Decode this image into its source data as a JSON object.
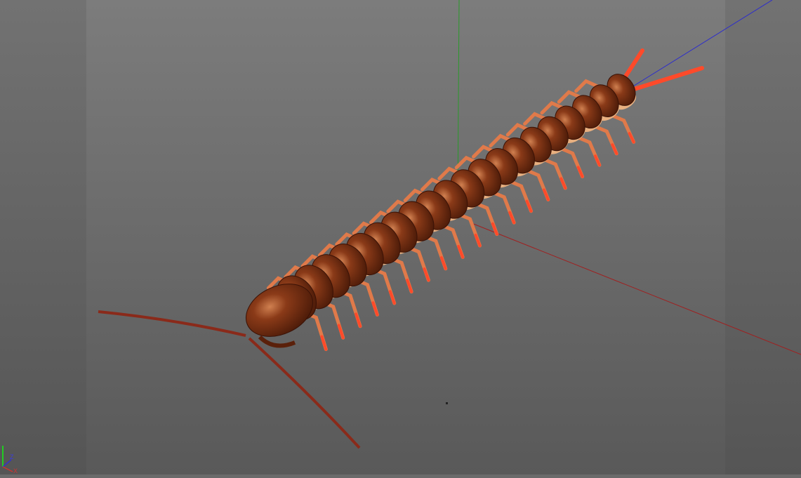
{
  "viewport": {
    "background_top": "#7c7c7c",
    "background_bottom": "#595959",
    "side_panel_color": "#6b6b6b",
    "axis_colors": {
      "x": "#b02020",
      "y": "#2a9a2a",
      "z": "#2a2ad0"
    }
  },
  "gizmo": {
    "z_label": "Z",
    "x_label": "X"
  },
  "model": {
    "body_color": "#7a3415",
    "highlight_color": "#c86a40",
    "leg_color": "#e07a4a",
    "leg_tip_color": "#ff4a2a",
    "segments": 20
  }
}
